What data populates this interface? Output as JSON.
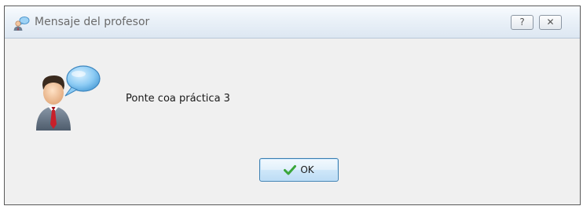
{
  "window": {
    "title": "Mensaje del profesor",
    "help_glyph": "?",
    "close_glyph": "✕"
  },
  "dialog": {
    "message": "Ponte coa práctica 3",
    "ok_label": "OK"
  },
  "icons": {
    "app": "teacher-message-icon",
    "main": "teacher-speech-bubble-icon",
    "ok": "green-check-icon"
  },
  "colors": {
    "ok_border": "#3c7fb1",
    "check_green": "#3aa63a",
    "speech_bubble": "#7fc4f2",
    "tie_red": "#c8202a"
  }
}
